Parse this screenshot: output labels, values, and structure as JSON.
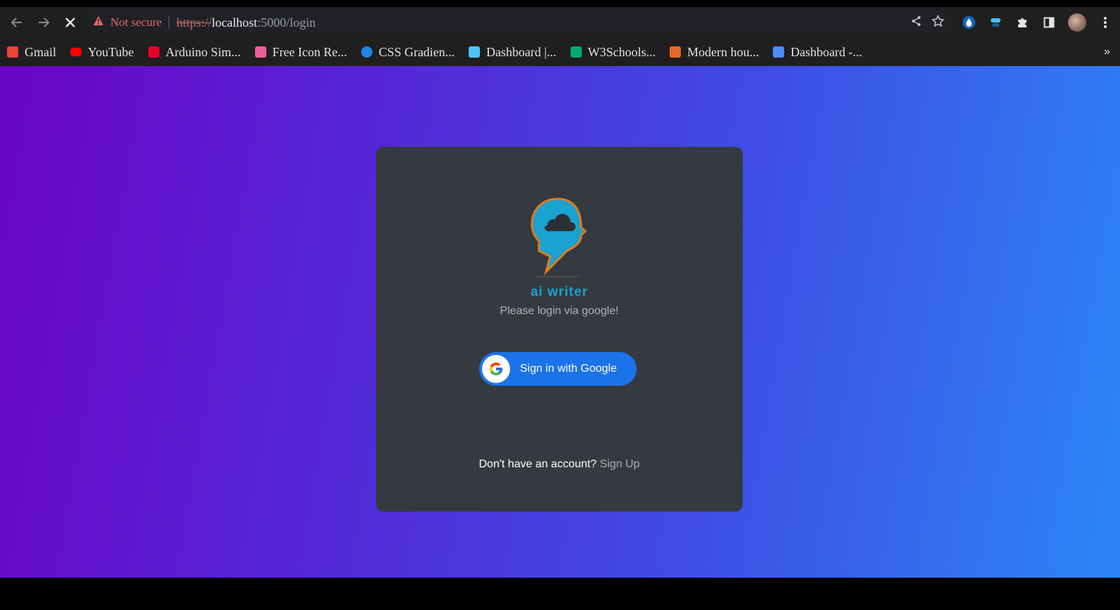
{
  "browser": {
    "security_label": "Not secure",
    "url": {
      "scheme": "https://",
      "host": "localhost",
      "rest": ":5000/login"
    },
    "bookmarks": [
      {
        "label": "Gmail",
        "icon": "gmail-icon",
        "color": "#ea4335"
      },
      {
        "label": "YouTube",
        "icon": "youtube-icon",
        "color": "#ff0000"
      },
      {
        "label": "Arduino Sim...",
        "icon": "arduino-sim-icon",
        "color": "#e4002b"
      },
      {
        "label": "Free Icon Re...",
        "icon": "free-icon-icon",
        "color": "#e95e9a"
      },
      {
        "label": "CSS Gradien...",
        "icon": "css-gradient-icon",
        "color": "#1e88e5"
      },
      {
        "label": "Dashboard |...",
        "icon": "dashboard-grid-icon",
        "color": "#4fc3f7"
      },
      {
        "label": "W3Schools...",
        "icon": "w3schools-icon",
        "color": "#04aa6d"
      },
      {
        "label": "Modern hou...",
        "icon": "modern-house-icon",
        "color": "#e56a2a"
      },
      {
        "label": "Dashboard -...",
        "icon": "dashboard-db-icon",
        "color": "#4e8cf5"
      }
    ]
  },
  "login": {
    "brand": "ai writer",
    "subtitle": "Please login via google!",
    "google_button_label": "Sign in with Google",
    "footer_question": "Don't have an account?",
    "signup_link": "Sign Up"
  },
  "colors": {
    "gradient_start": "#6a04c6",
    "gradient_end": "#2c86f6",
    "card": "#343a40",
    "brand": "#1aa3d0",
    "google_blue": "#1a73e8"
  }
}
